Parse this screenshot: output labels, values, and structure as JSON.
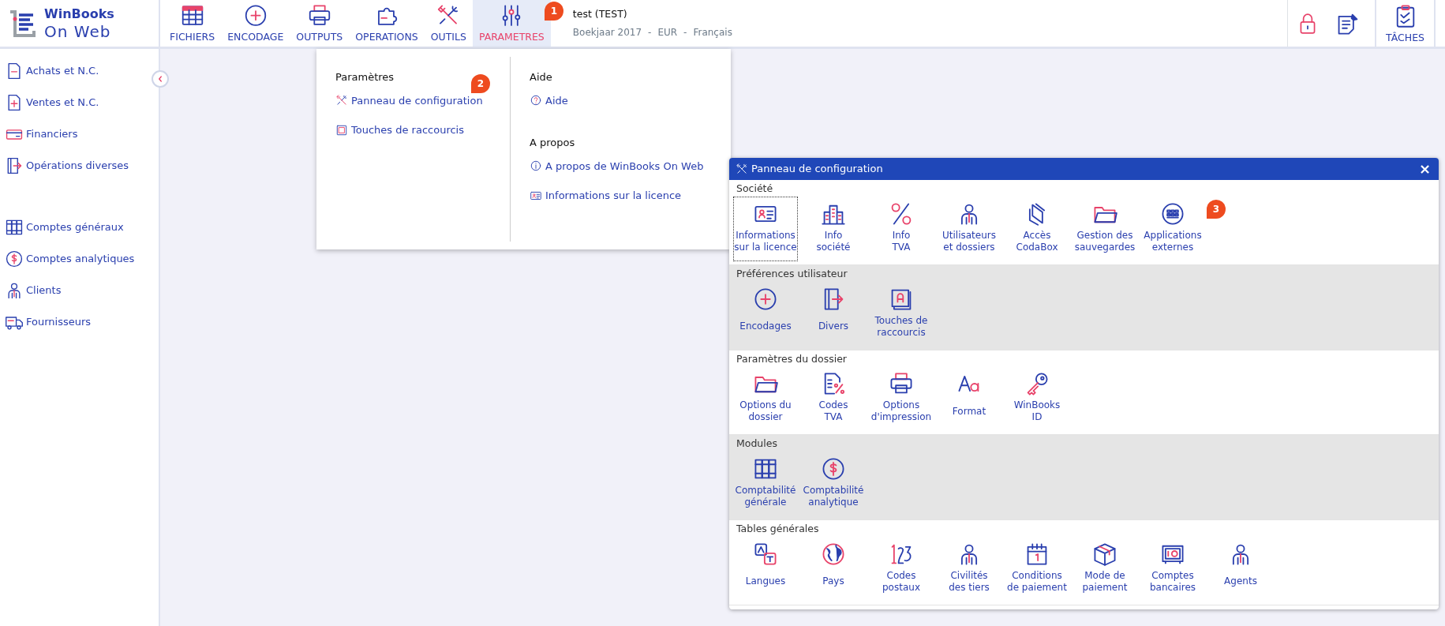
{
  "logo": {
    "name": "WinBooks",
    "sub": "On Web"
  },
  "nav_tabs": [
    {
      "label": "FICHIERS",
      "selected": false
    },
    {
      "label": "ENCODAGE",
      "selected": false
    },
    {
      "label": "OUTPUTS",
      "selected": false
    },
    {
      "label": "OPERATIONS",
      "selected": false
    },
    {
      "label": "OUTILS",
      "selected": false
    },
    {
      "label": "PARAMETRES",
      "selected": true,
      "callout": "1"
    }
  ],
  "file_info": {
    "title": "test (TEST)",
    "details": [
      "Boekjaar 2017",
      "-",
      "EUR",
      "-",
      "Français"
    ]
  },
  "tasks_button": {
    "label": "TÂCHES"
  },
  "sidebar": {
    "groups": [
      [
        "Achats et N.C.",
        "Ventes et N.C.",
        "Financiers",
        "Opérations diverses"
      ],
      [
        "Comptes généraux",
        "Comptes analytiques",
        "Clients",
        "Fournisseurs"
      ]
    ]
  },
  "menu": {
    "columns": [
      {
        "sections": [
          {
            "heading": "Paramètres",
            "items": [
              {
                "label": "Panneau de configuration",
                "callout": "2"
              },
              {
                "label": "Touches de raccourcis"
              }
            ]
          }
        ]
      },
      {
        "sections": [
          {
            "heading": "Aide",
            "items": [
              {
                "label": "Aide"
              }
            ]
          },
          {
            "heading": "A propos",
            "items": [
              {
                "label": "A propos de WinBooks On Web"
              },
              {
                "label": "Informations sur la licence"
              }
            ]
          }
        ]
      }
    ]
  },
  "panel": {
    "title": "Panneau de configuration",
    "close": "×",
    "sections": [
      {
        "heading": "Société",
        "shaded": false,
        "items": [
          {
            "label": "Informations\nsur la licence",
            "focused": true
          },
          {
            "label": "Info\nsociété",
            "focused": false
          },
          {
            "label": "Info\nTVA",
            "focused": false
          },
          {
            "label": "Utilisateurs\net dossiers",
            "focused": false
          },
          {
            "label": "Accès\nCodaBox",
            "focused": false
          },
          {
            "label": "Gestion des\nsauvegardes",
            "focused": false
          },
          {
            "label": "Applications\nexternes",
            "focused": false,
            "callout": "3"
          }
        ]
      },
      {
        "heading": "Préférences utilisateur",
        "shaded": true,
        "items": [
          {
            "label": "Encodages",
            "focused": false
          },
          {
            "label": "Divers",
            "focused": false
          },
          {
            "label": "Touches de\nraccourcis",
            "focused": false
          }
        ]
      },
      {
        "heading": "Paramètres du dossier",
        "shaded": false,
        "items": [
          {
            "label": "Options du\ndossier",
            "focused": false
          },
          {
            "label": "Codes\nTVA",
            "focused": false
          },
          {
            "label": "Options\nd'impression",
            "focused": false
          },
          {
            "label": "Format",
            "focused": false
          },
          {
            "label": "WinBooks\nID",
            "focused": false
          }
        ]
      },
      {
        "heading": "Modules",
        "shaded": true,
        "items": [
          {
            "label": "Comptabilité\ngénérale",
            "focused": false
          },
          {
            "label": "Comptabilité\nanalytique",
            "focused": false
          }
        ]
      },
      {
        "heading": "Tables générales",
        "shaded": false,
        "items": [
          {
            "label": "Langues",
            "focused": false
          },
          {
            "label": "Pays",
            "focused": false
          },
          {
            "label": "Codes\npostaux",
            "focused": false
          },
          {
            "label": "Civilités\ndes tiers",
            "focused": false
          },
          {
            "label": "Conditions\nde paiement",
            "focused": false
          },
          {
            "label": "Mode de\npaiement",
            "focused": false
          },
          {
            "label": "Comptes\nbancaires",
            "focused": false
          },
          {
            "label": "Agents",
            "focused": false
          }
        ]
      }
    ]
  }
}
